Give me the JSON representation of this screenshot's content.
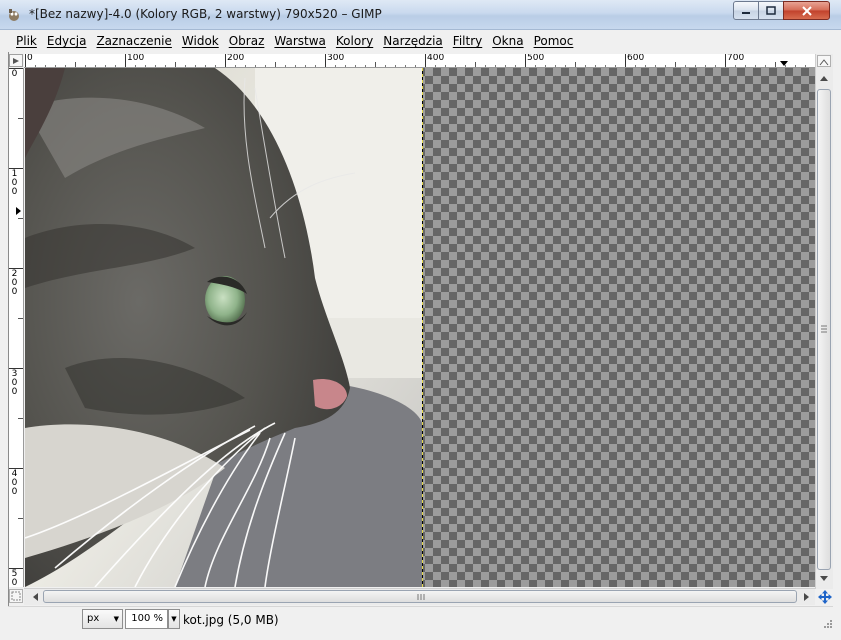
{
  "window": {
    "title": "*[Bez nazwy]-4.0 (Kolory RGB, 2 warstwy) 790x520 – GIMP",
    "icon": "gimp-app-icon",
    "controls": [
      "minimize",
      "maximize",
      "close"
    ]
  },
  "menubar": {
    "items": [
      "Plik",
      "Edycja",
      "Zaznaczenie",
      "Widok",
      "Obraz",
      "Warstwa",
      "Kolory",
      "Narzędzia",
      "Filtry",
      "Okna",
      "Pomoc"
    ]
  },
  "rulers": {
    "horizontal": [
      "0",
      "100",
      "200",
      "300",
      "400",
      "500",
      "600",
      "700"
    ],
    "vertical": [
      [
        "0"
      ],
      [
        "1",
        "0",
        "0"
      ],
      [
        "2",
        "0",
        "0"
      ],
      [
        "3",
        "0",
        "0"
      ],
      [
        "4",
        "0",
        "0"
      ],
      [
        "5",
        "0"
      ]
    ]
  },
  "canvas": {
    "image_width": 790,
    "image_height": 520,
    "photo_layer_content": "cat-profile-photo",
    "transparent_region": "checkerboard",
    "boundary_color": "#e6d94a"
  },
  "statusbar": {
    "unit": "px",
    "zoom": "100 %",
    "file_info": "kot.jpg (5,0 MB)"
  },
  "colors": {
    "titlebar": "#c9d9ee",
    "close_button": "#c1412b",
    "checker_dark": "#666666",
    "checker_light": "#9c9c9c"
  }
}
